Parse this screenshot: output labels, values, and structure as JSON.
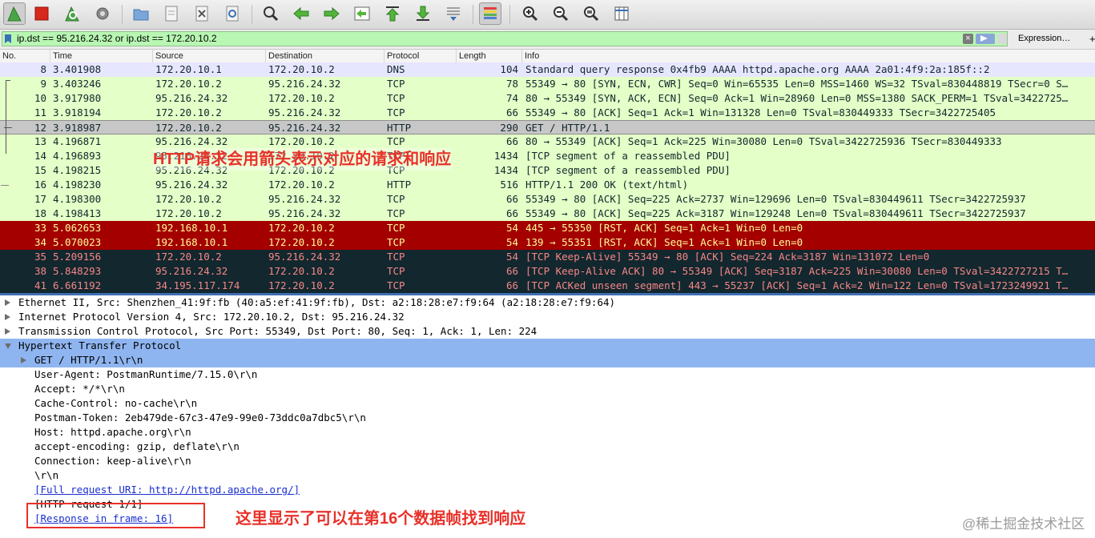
{
  "toolbar": {
    "buttons": [
      "start-capture",
      "stop-capture",
      "restart-capture",
      "capture-options",
      "open-file",
      "save-file",
      "close-file",
      "reload-file",
      "find-packet",
      "go-back",
      "go-forward",
      "go-to-packet",
      "go-first",
      "go-last",
      "auto-scroll",
      "colorize",
      "zoom-in",
      "zoom-out",
      "zoom-normal",
      "resize-columns"
    ]
  },
  "filter": {
    "value": "ip.dst == 95.216.24.32 or ip.dst == 172.20.10.2",
    "expression_label": "Expression…",
    "plus_label": "+"
  },
  "packet_list": {
    "columns": [
      "No.",
      "Time",
      "Source",
      "Destination",
      "Protocol",
      "Length",
      "Info"
    ],
    "rows": [
      {
        "no": "8",
        "time": "3.401908",
        "src": "172.20.10.1",
        "dst": "172.20.10.2",
        "proto": "DNS",
        "len": "104",
        "info": "Standard query response 0x4fb9 AAAA httpd.apache.org AAAA 2a01:4f9:2a:185f::2",
        "style": "blue"
      },
      {
        "no": "9",
        "time": "3.403246",
        "src": "172.20.10.2",
        "dst": "95.216.24.32",
        "proto": "TCP",
        "len": "78",
        "info": "55349 → 80 [SYN, ECN, CWR] Seq=0 Win=65535 Len=0 MSS=1460 WS=32 TSval=830448819 TSecr=0 S…",
        "style": "green"
      },
      {
        "no": "10",
        "time": "3.917980",
        "src": "95.216.24.32",
        "dst": "172.20.10.2",
        "proto": "TCP",
        "len": "74",
        "info": "80 → 55349 [SYN, ACK, ECN] Seq=0 Ack=1 Win=28960 Len=0 MSS=1380 SACK_PERM=1 TSval=3422725…",
        "style": "green"
      },
      {
        "no": "11",
        "time": "3.918194",
        "src": "172.20.10.2",
        "dst": "95.216.24.32",
        "proto": "TCP",
        "len": "66",
        "info": "55349 → 80 [ACK] Seq=1 Ack=1 Win=131328 Len=0 TSval=830449333 TSecr=3422725405",
        "style": "green"
      },
      {
        "no": "12",
        "time": "3.918987",
        "src": "172.20.10.2",
        "dst": "95.216.24.32",
        "proto": "HTTP",
        "len": "290",
        "info": "GET / HTTP/1.1",
        "style": "sel"
      },
      {
        "no": "13",
        "time": "4.196871",
        "src": "95.216.24.32",
        "dst": "172.20.10.2",
        "proto": "TCP",
        "len": "66",
        "info": "80 → 55349 [ACK] Seq=1 Ack=225 Win=30080 Len=0 TSval=3422725936 TSecr=830449333",
        "style": "green"
      },
      {
        "no": "14",
        "time": "4.196893",
        "src": "95.216.24.32",
        "dst": "172.20.10.2",
        "proto": "TCP",
        "len": "1434",
        "info": "[TCP segment of a reassembled PDU]",
        "style": "green"
      },
      {
        "no": "15",
        "time": "4.198215",
        "src": "95.216.24.32",
        "dst": "172.20.10.2",
        "proto": "TCP",
        "len": "1434",
        "info": "[TCP segment of a reassembled PDU]",
        "style": "green"
      },
      {
        "no": "16",
        "time": "4.198230",
        "src": "95.216.24.32",
        "dst": "172.20.10.2",
        "proto": "HTTP",
        "len": "516",
        "info": "HTTP/1.1 200 OK  (text/html)",
        "style": "green"
      },
      {
        "no": "17",
        "time": "4.198300",
        "src": "172.20.10.2",
        "dst": "95.216.24.32",
        "proto": "TCP",
        "len": "66",
        "info": "55349 → 80 [ACK] Seq=225 Ack=2737 Win=129696 Len=0 TSval=830449611 TSecr=3422725937",
        "style": "green"
      },
      {
        "no": "18",
        "time": "4.198413",
        "src": "172.20.10.2",
        "dst": "95.216.24.32",
        "proto": "TCP",
        "len": "66",
        "info": "55349 → 80 [ACK] Seq=225 Ack=3187 Win=129248 Len=0 TSval=830449611 TSecr=3422725937",
        "style": "green"
      },
      {
        "no": "33",
        "time": "5.062653",
        "src": "192.168.10.1",
        "dst": "172.20.10.2",
        "proto": "TCP",
        "len": "54",
        "info": "445 → 55350 [RST, ACK] Seq=1 Ack=1 Win=0 Len=0",
        "style": "red"
      },
      {
        "no": "34",
        "time": "5.070023",
        "src": "192.168.10.1",
        "dst": "172.20.10.2",
        "proto": "TCP",
        "len": "54",
        "info": "139 → 55351 [RST, ACK] Seq=1 Ack=1 Win=0 Len=0",
        "style": "red"
      },
      {
        "no": "35",
        "time": "5.209156",
        "src": "172.20.10.2",
        "dst": "95.216.24.32",
        "proto": "TCP",
        "len": "54",
        "info": "[TCP Keep-Alive] 55349 → 80 [ACK] Seq=224 Ack=3187 Win=131072 Len=0",
        "style": "dark"
      },
      {
        "no": "38",
        "time": "5.848293",
        "src": "95.216.24.32",
        "dst": "172.20.10.2",
        "proto": "TCP",
        "len": "66",
        "info": "[TCP Keep-Alive ACK] 80 → 55349 [ACK] Seq=3187 Ack=225 Win=30080 Len=0 TSval=3422727215 T…",
        "style": "dark"
      },
      {
        "no": "41",
        "time": "6.661192",
        "src": "34.195.117.174",
        "dst": "172.20.10.2",
        "proto": "TCP",
        "len": "66",
        "info": "[TCP ACKed unseen segment] 443 → 55237 [ACK] Seq=1 Ack=2 Win=122 Len=0 TSval=1723249921 T…",
        "style": "dark"
      }
    ]
  },
  "details": [
    {
      "text": "Ethernet II, Src: Shenzhen_41:9f:fb (40:a5:ef:41:9f:fb), Dst: a2:18:28:e7:f9:64 (a2:18:28:e7:f9:64)",
      "level": 0,
      "toggle": "right"
    },
    {
      "text": "Internet Protocol Version 4, Src: 172.20.10.2, Dst: 95.216.24.32",
      "level": 0,
      "toggle": "right"
    },
    {
      "text": "Transmission Control Protocol, Src Port: 55349, Dst Port: 80, Seq: 1, Ack: 1, Len: 224",
      "level": 0,
      "toggle": "right"
    },
    {
      "text": "Hypertext Transfer Protocol",
      "level": 0,
      "toggle": "down",
      "highlight": true
    },
    {
      "text": "GET / HTTP/1.1\\r\\n",
      "level": 1,
      "toggle": "right",
      "highlight": true
    },
    {
      "text": "User-Agent: PostmanRuntime/7.15.0\\r\\n",
      "level": 1,
      "toggle": ""
    },
    {
      "text": "Accept: */*\\r\\n",
      "level": 1,
      "toggle": ""
    },
    {
      "text": "Cache-Control: no-cache\\r\\n",
      "level": 1,
      "toggle": ""
    },
    {
      "text": "Postman-Token: 2eb479de-67c3-47e9-99e0-73ddc0a7dbc5\\r\\n",
      "level": 1,
      "toggle": ""
    },
    {
      "text": "Host: httpd.apache.org\\r\\n",
      "level": 1,
      "toggle": ""
    },
    {
      "text": "accept-encoding: gzip, deflate\\r\\n",
      "level": 1,
      "toggle": ""
    },
    {
      "text": "Connection: keep-alive\\r\\n",
      "level": 1,
      "toggle": ""
    },
    {
      "text": "\\r\\n",
      "level": 1,
      "toggle": ""
    },
    {
      "text": "[Full request URI: http://httpd.apache.org/]",
      "level": 1,
      "toggle": "",
      "link": true
    },
    {
      "text": "[HTTP request 1/1]",
      "level": 1,
      "toggle": ""
    },
    {
      "text": "[Response in frame: 16]",
      "level": 1,
      "toggle": "",
      "link": true
    }
  ],
  "annotations": {
    "top": "HTTP请求会用箭头表示对应的请求和响应",
    "bottom": "这里显示了可以在第16个数据帧找到响应",
    "watermark": "@稀土掘金技术社区"
  },
  "colors": {
    "filter_valid": "#b8f7b3",
    "row_tcp": "#e4ffc7",
    "row_dns": "#e7e6ff",
    "row_rst": "#a40000",
    "row_bad": "#12272e",
    "annotation": "#e8312a",
    "detail_highlight": "#8fb5f0"
  }
}
